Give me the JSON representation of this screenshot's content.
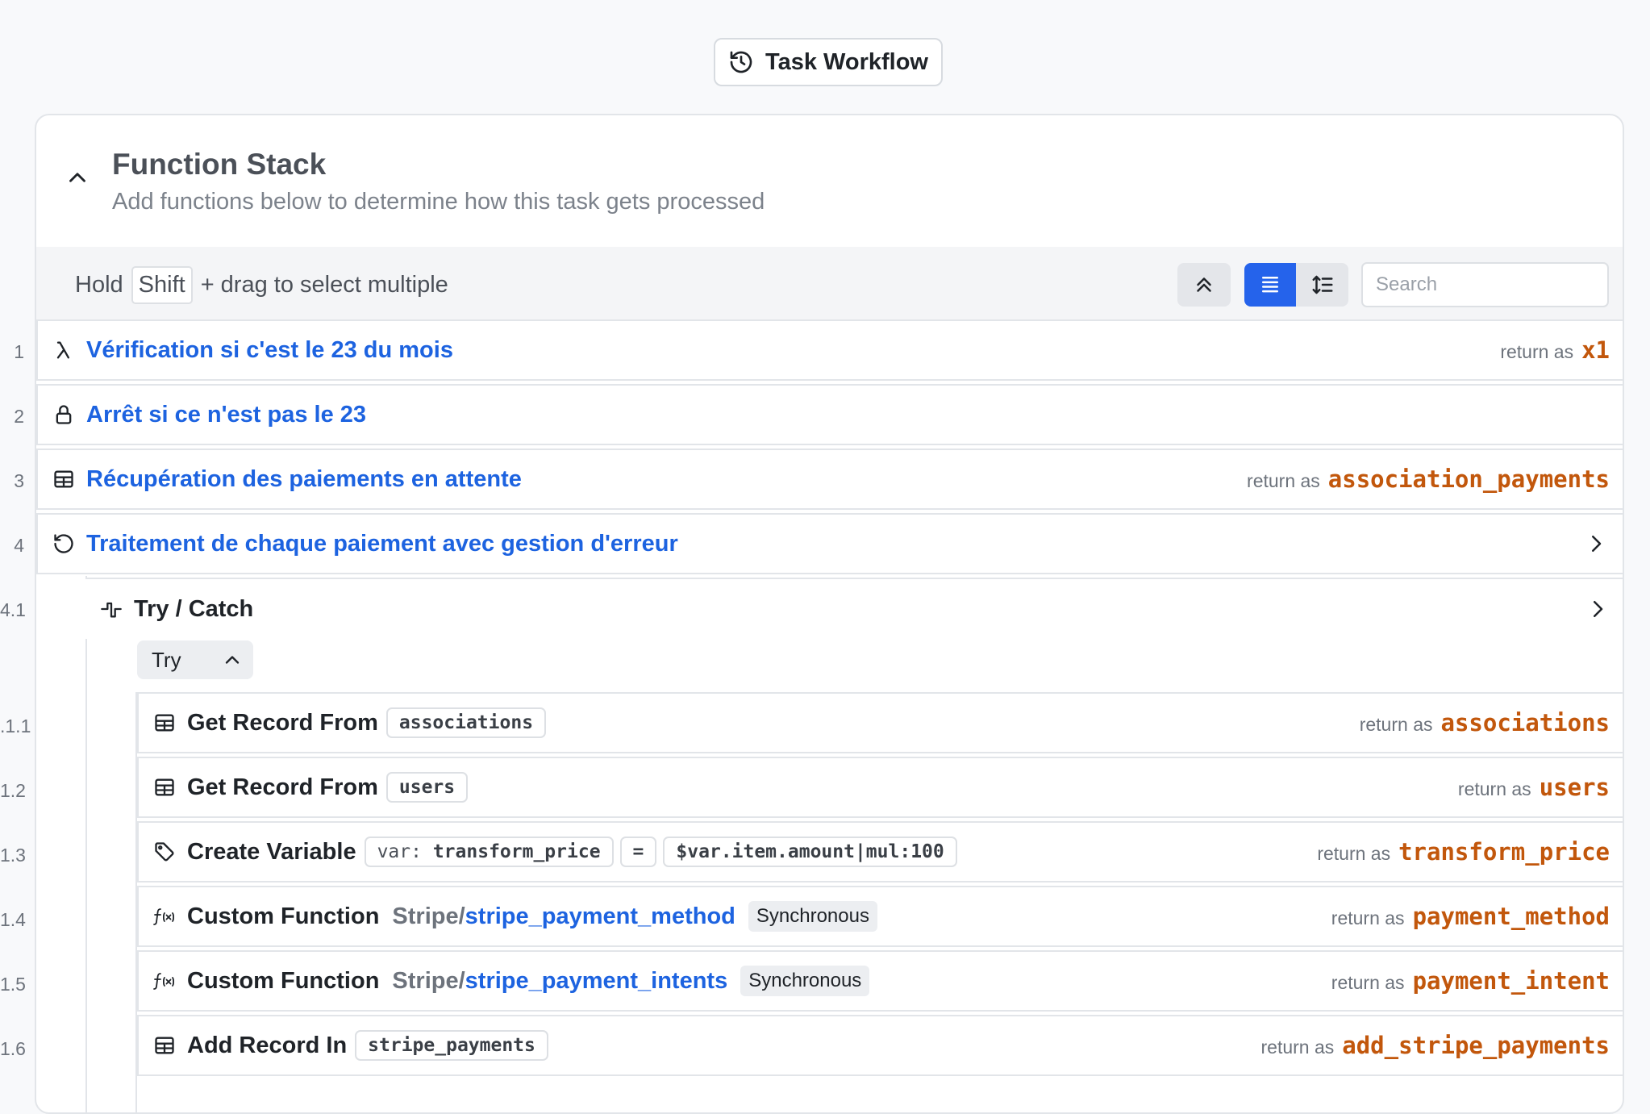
{
  "header": {
    "title": "Task Workflow"
  },
  "stack": {
    "title": "Function Stack",
    "subtitle": "Add functions below to determine how this task gets processed"
  },
  "toolbar": {
    "hint_prefix": "Hold",
    "hint_key": "Shift",
    "hint_suffix": "+ drag to select multiple",
    "search_placeholder": "Search",
    "view_mode": "list",
    "accent": "#2563eb"
  },
  "return_label": "return as",
  "rows": [
    {
      "num": "1",
      "icon": "lambda-icon",
      "label": "Vérification si c'est le 23 du mois",
      "return_var": "x1"
    },
    {
      "num": "2",
      "icon": "lock-icon",
      "label": "Arrêt si ce n'est pas le 23"
    },
    {
      "num": "3",
      "icon": "table-icon",
      "label": "Récupération des paiements en attente",
      "return_var": "association_payments"
    },
    {
      "num": "4",
      "icon": "loop-icon",
      "label": "Traitement de chaque paiement avec gestion d'erreur"
    }
  ],
  "trycatch": {
    "num": "4.1",
    "label": "Try / Catch",
    "try_label": "Try"
  },
  "inner": [
    {
      "num": ".1.1",
      "icon": "table-icon",
      "label": "Get Record From",
      "chip": "associations",
      "return_var": "associations"
    },
    {
      "num": "1.2",
      "icon": "table-icon",
      "label": "Get Record From",
      "chip": "users",
      "return_var": "users"
    },
    {
      "num": "1.3",
      "icon": "tag-icon",
      "label": "Create Variable",
      "var_key": "var:",
      "var_name": "transform_price",
      "eq": "=",
      "expr": "$var.item.amount|mul:100",
      "return_var": "transform_price"
    },
    {
      "num": "1.4",
      "icon": "function-icon",
      "label": "Custom Function",
      "path_prefix": "Stripe/",
      "path_fn": "stripe_payment_method",
      "mode": "Synchronous",
      "return_var": "payment_method"
    },
    {
      "num": "1.5",
      "icon": "function-icon",
      "label": "Custom Function",
      "path_prefix": "Stripe/",
      "path_fn": "stripe_payment_intents",
      "mode": "Synchronous",
      "return_var": "payment_intent"
    },
    {
      "num": "1.6",
      "icon": "table-icon",
      "label": "Add Record In",
      "chip": "stripe_payments",
      "return_var": "add_stripe_payments"
    }
  ]
}
